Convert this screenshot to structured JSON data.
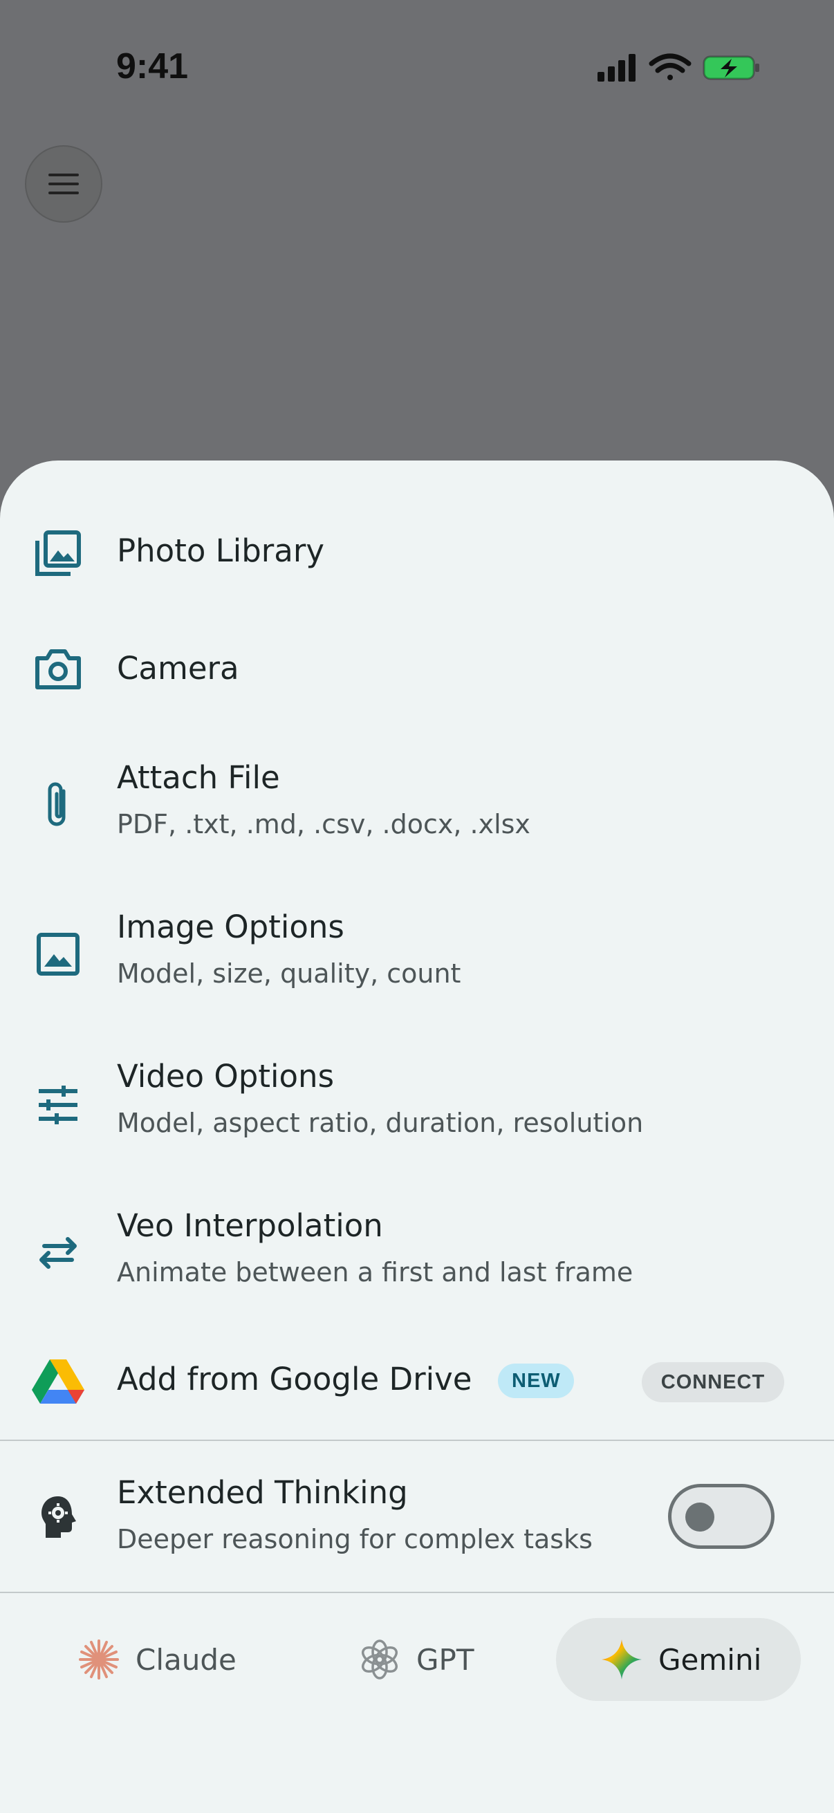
{
  "status_bar": {
    "time": "9:41"
  },
  "top_bar": {
    "menu_icon": "hamburger-menu-icon"
  },
  "sheet": {
    "items": [
      {
        "title": "Photo Library",
        "subtitle": "",
        "icon": "photo-library-icon"
      },
      {
        "title": "Camera",
        "subtitle": "",
        "icon": "camera-icon"
      },
      {
        "title": "Attach File",
        "subtitle": "PDF, .txt, .md, .csv, .docx, .xlsx",
        "icon": "paperclip-icon"
      },
      {
        "title": "Image Options",
        "subtitle": "Model, size, quality, count",
        "icon": "image-icon"
      },
      {
        "title": "Video Options",
        "subtitle": "Model, aspect ratio, duration, resolution",
        "icon": "tune-sliders-icon"
      },
      {
        "title": "Veo Interpolation",
        "subtitle": "Animate between a first and last frame",
        "icon": "swap-arrows-icon"
      }
    ],
    "drive": {
      "title": "Add from Google Drive",
      "badge": "NEW",
      "action": "CONNECT",
      "icon": "google-drive-icon"
    },
    "thinking": {
      "title": "Extended Thinking",
      "subtitle": "Deeper reasoning for complex tasks",
      "enabled": false,
      "icon": "brain-gear-icon"
    },
    "models": [
      {
        "label": "Claude",
        "icon": "claude-starburst-icon",
        "active": false
      },
      {
        "label": "GPT",
        "icon": "openai-knot-icon",
        "active": false
      },
      {
        "label": "Gemini",
        "icon": "gemini-sparkle-icon",
        "active": true
      }
    ],
    "colors": {
      "accent": "#1e6a7e",
      "sheet_bg": "#eff4f4",
      "scrim": "#6e6f72",
      "badge_bg": "#bfe9f7"
    }
  }
}
